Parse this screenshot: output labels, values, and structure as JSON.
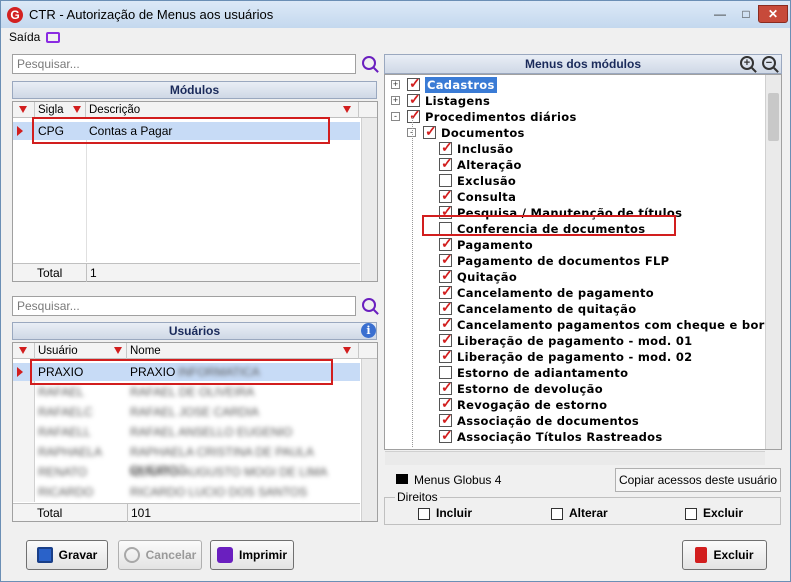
{
  "window": {
    "title": "CTR - Autorização de Menus aos usuários",
    "app_icon_letter": "G"
  },
  "menu": {
    "saida": "Saída"
  },
  "modulos": {
    "search_placeholder": "Pesquisar...",
    "header": "Módulos",
    "col_sigla": "Sigla",
    "col_descricao": "Descrição",
    "rows": [
      {
        "sigla": "CPG",
        "descricao": "Contas a Pagar"
      }
    ],
    "total_label": "Total",
    "total_value": "1"
  },
  "usuarios": {
    "search_placeholder": "Pesquisar...",
    "header": "Usuários",
    "col_usuario": "Usuário",
    "col_nome": "Nome",
    "rows": [
      {
        "usuario": "PRAXIO",
        "nome": "PRAXIO",
        "nome_blur": "INFORMATICA"
      },
      {
        "usuario": "RAFAEL",
        "nome": "RAFAEL DE OLIVEIRA"
      },
      {
        "usuario": "RAFAELC",
        "nome": "RAFAEL JOSE CARDIA"
      },
      {
        "usuario": "RAFAELL",
        "nome": "RAFAEL ANSELLO EUGENIO"
      },
      {
        "usuario": "RAPHAELA",
        "nome": "RAPHAELA CRISTINA DE PAULA QUEIROZ"
      },
      {
        "usuario": "RENATO",
        "nome": "RENATO AUGUSTO MOGI DE LIMA"
      },
      {
        "usuario": "RICARDO",
        "nome": "RICARDO LUCIO DOS SANTOS"
      }
    ],
    "total_label": "Total",
    "total_value": "101"
  },
  "menus": {
    "header": "Menus dos módulos",
    "items": [
      {
        "label": "Cadastros",
        "checked": true,
        "level": 0,
        "expander": "+",
        "selected": true
      },
      {
        "label": "Listagens",
        "checked": true,
        "level": 0,
        "expander": "+"
      },
      {
        "label": "Procedimentos diários",
        "checked": true,
        "level": 0,
        "expander": "-"
      },
      {
        "label": "Documentos",
        "checked": true,
        "level": 1,
        "expander": "-"
      },
      {
        "label": "Inclusão",
        "checked": true,
        "level": 2
      },
      {
        "label": "Alteração",
        "checked": true,
        "level": 2
      },
      {
        "label": "Exclusão",
        "checked": false,
        "level": 2
      },
      {
        "label": "Consulta",
        "checked": true,
        "level": 2
      },
      {
        "label": "Pesquisa / Manutenção de títulos",
        "checked": true,
        "level": 2
      },
      {
        "label": "Conferencia de documentos",
        "checked": false,
        "level": 2
      },
      {
        "label": "Pagamento",
        "checked": true,
        "level": 2
      },
      {
        "label": "Pagamento de documentos FLP",
        "checked": true,
        "level": 2
      },
      {
        "label": "Quitação",
        "checked": true,
        "level": 2
      },
      {
        "label": "Cancelamento de pagamento",
        "checked": true,
        "level": 2
      },
      {
        "label": "Cancelamento de quitação",
        "checked": true,
        "level": 2
      },
      {
        "label": "Cancelamento pagamentos com cheque e bor",
        "checked": true,
        "level": 2
      },
      {
        "label": "Liberação de pagamento - mod. 01",
        "checked": true,
        "level": 2
      },
      {
        "label": "Liberação de pagamento - mod. 02",
        "checked": true,
        "level": 2
      },
      {
        "label": "Estorno de adiantamento",
        "checked": false,
        "level": 2
      },
      {
        "label": "Estorno de devolução",
        "checked": true,
        "level": 2
      },
      {
        "label": "Revogação de estorno",
        "checked": true,
        "level": 2
      },
      {
        "label": "Associação de documentos",
        "checked": true,
        "level": 2
      },
      {
        "label": "Associação Títulos Rastreados",
        "checked": true,
        "level": 2
      }
    ],
    "legend_label": "Menus Globus 4",
    "copy_button": "Copiar acessos deste usuário"
  },
  "direitos": {
    "label": "Direitos",
    "incluir": "Incluir",
    "alterar": "Alterar",
    "excluir": "Excluir"
  },
  "buttons": {
    "gravar": "Gravar",
    "cancelar": "Cancelar",
    "imprimir": "Imprimir",
    "excluir": "Excluir"
  },
  "colors": {
    "accent_red": "#d21e1e",
    "selection": "#c7dbf6",
    "header_text": "#1a2a5a"
  }
}
